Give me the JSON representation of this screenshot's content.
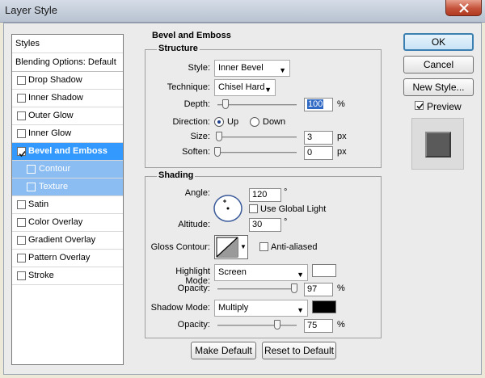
{
  "window": {
    "title": "Layer Style"
  },
  "styles_list": {
    "header": "Styles",
    "blending_options": "Blending Options: Default",
    "items": [
      {
        "label": "Drop Shadow",
        "checked": false
      },
      {
        "label": "Inner Shadow",
        "checked": false
      },
      {
        "label": "Outer Glow",
        "checked": false
      },
      {
        "label": "Inner Glow",
        "checked": false
      },
      {
        "label": "Bevel and Emboss",
        "checked": true,
        "selected": true
      },
      {
        "label": "Contour",
        "checked": false,
        "sub": true
      },
      {
        "label": "Texture",
        "checked": false,
        "sub": true
      },
      {
        "label": "Satin",
        "checked": false
      },
      {
        "label": "Color Overlay",
        "checked": false
      },
      {
        "label": "Gradient Overlay",
        "checked": false
      },
      {
        "label": "Pattern Overlay",
        "checked": false
      },
      {
        "label": "Stroke",
        "checked": false
      }
    ]
  },
  "bevel": {
    "section_title": "Bevel and Emboss",
    "structure": {
      "title": "Structure",
      "style_label": "Style:",
      "style_value": "Inner Bevel",
      "technique_label": "Technique:",
      "technique_value": "Chisel Hard",
      "depth_label": "Depth:",
      "depth_value": "100",
      "depth_unit": "%",
      "depth_level": 0.1,
      "direction_label": "Direction:",
      "direction_up": "Up",
      "direction_down": "Down",
      "direction_selected": "Up",
      "size_label": "Size:",
      "size_value": "3",
      "size_unit": "px",
      "size_level": 0.02,
      "soften_label": "Soften:",
      "soften_value": "0",
      "soften_unit": "px",
      "soften_level": 0.0
    },
    "shading": {
      "title": "Shading",
      "angle_label": "Angle:",
      "angle_value": "120",
      "angle_unit": "°",
      "global_light_label": "Use Global Light",
      "global_light_checked": false,
      "altitude_label": "Altitude:",
      "altitude_value": "30",
      "altitude_unit": "°",
      "gloss_label": "Gloss Contour:",
      "anti_aliased_label": "Anti-aliased",
      "anti_aliased_checked": false,
      "highlight_mode_label": "Highlight Mode:",
      "highlight_mode_value": "Screen",
      "highlight_color": "#ffffff",
      "highlight_opacity_label": "Opacity:",
      "highlight_opacity_value": "97",
      "highlight_opacity_unit": "%",
      "highlight_opacity_level": 0.97,
      "shadow_mode_label": "Shadow Mode:",
      "shadow_mode_value": "Multiply",
      "shadow_color": "#000000",
      "shadow_opacity_label": "Opacity:",
      "shadow_opacity_value": "75",
      "shadow_opacity_unit": "%",
      "shadow_opacity_level": 0.75
    },
    "make_default_label": "Make Default",
    "reset_default_label": "Reset to Default"
  },
  "actions": {
    "ok_label": "OK",
    "cancel_label": "Cancel",
    "new_style_label": "New Style...",
    "preview_label": "Preview",
    "preview_checked": true
  },
  "colors": {
    "selection": "#3399ff",
    "sub_selection": "#8bbdf2"
  }
}
